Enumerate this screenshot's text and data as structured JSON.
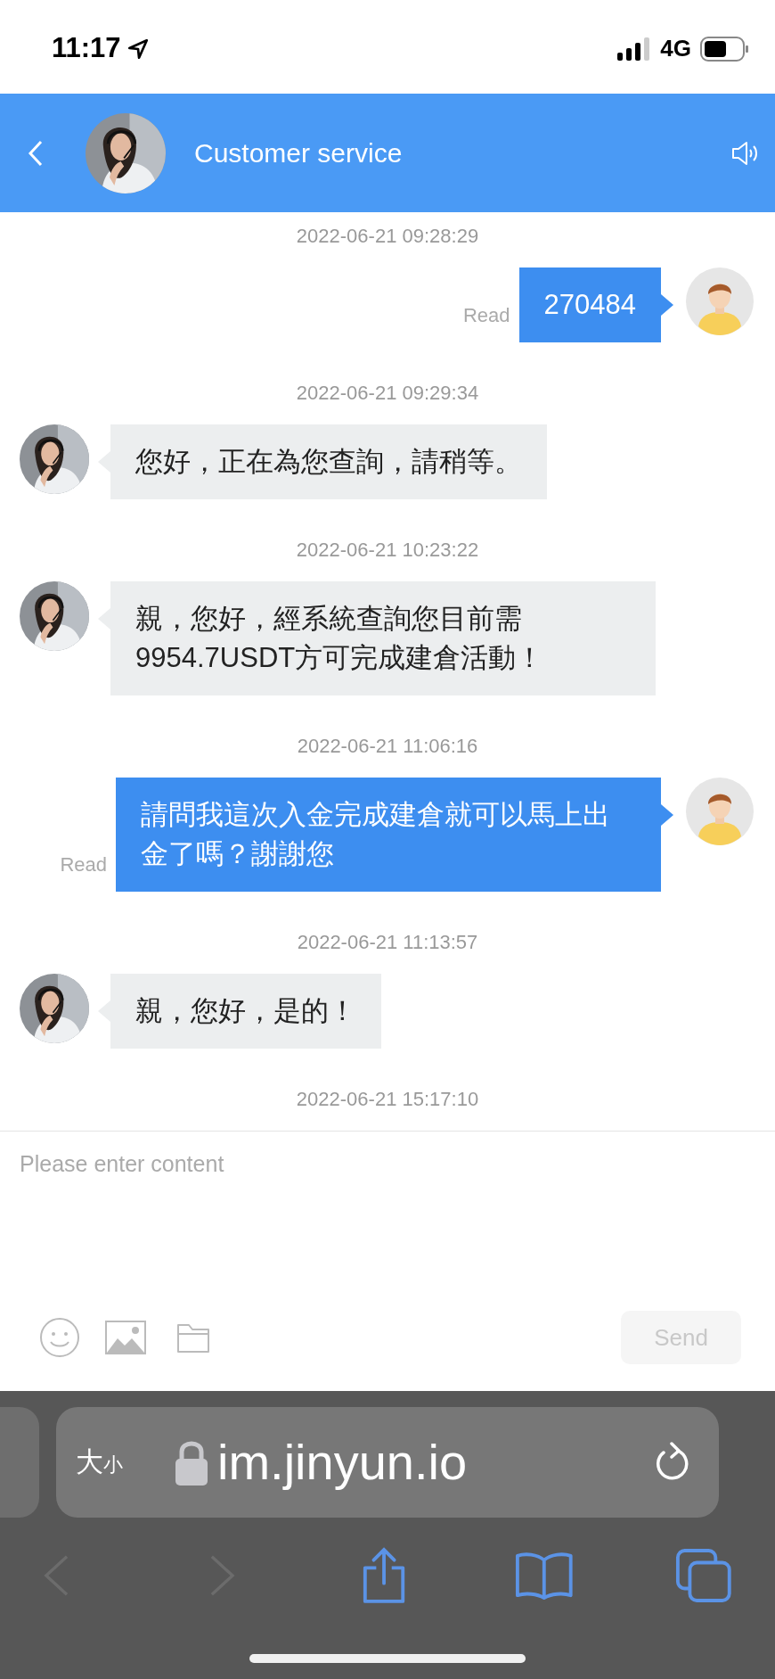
{
  "status_bar": {
    "time": "11:17",
    "network": "4G"
  },
  "header": {
    "title": "Customer service"
  },
  "messages": [
    {
      "timestamp": "2022-06-21 09:28:29",
      "kind": "sent",
      "text": "270484",
      "status": "Read"
    },
    {
      "timestamp": "2022-06-21 09:29:34",
      "kind": "received",
      "text": "您好，正在為您查詢，請稍等。"
    },
    {
      "timestamp": "2022-06-21 10:23:22",
      "kind": "received",
      "text": "親，您好，經系統查詢您目前需9954.7USDT方可完成建倉活動！"
    },
    {
      "timestamp": "2022-06-21 11:06:16",
      "kind": "sent",
      "text": "請問我這次入金完成建倉就可以馬上出金了嗎？謝謝您",
      "status": "Read"
    },
    {
      "timestamp": "2022-06-21 11:13:57",
      "kind": "received",
      "text": "親，您好，是的！"
    },
    {
      "timestamp": "2022-06-21 15:17:10"
    }
  ],
  "composer": {
    "placeholder": "Please enter content",
    "send_label": "Send",
    "send_disabled": true
  },
  "browser": {
    "text_size": {
      "large": "大",
      "small": "小"
    },
    "url": "im.jinyun.io",
    "back_disabled": true,
    "forward_disabled": true
  }
}
